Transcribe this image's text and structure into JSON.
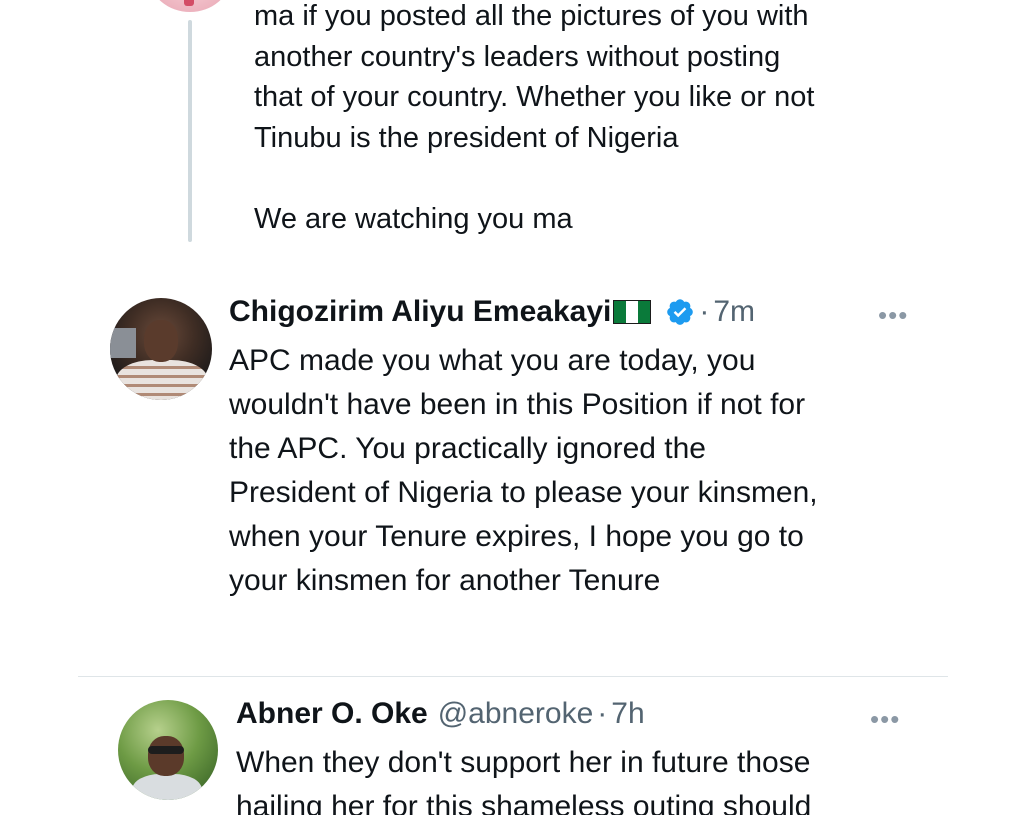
{
  "tweet1": {
    "lines": [
      "ma if you posted all the pictures of you with",
      "another country's leaders without posting",
      "that of your country. Whether you like or not",
      "Tinubu is the president of Nigeria",
      "We are watching you ma"
    ]
  },
  "tweet2": {
    "author_name": "Chigozirim Aliyu Emeakayi",
    "separator": "·",
    "time": "7m",
    "more": "•••",
    "flag_icon": "nigeria-flag-icon",
    "verified_icon": "verified-badge-icon",
    "verified_color": "#1d9bf0",
    "lines": [
      "APC made you what you are today, you",
      "wouldn't have been in this Position if not for",
      "the APC. You practically ignored the",
      "President of Nigeria to please your kinsmen,",
      "when your Tenure expires, I hope you go to",
      "your kinsmen for another Tenure"
    ]
  },
  "tweet3": {
    "author_name": "Abner O. Oke",
    "handle": "@abneroke",
    "separator": "·",
    "time": "7h",
    "more": "•••",
    "lines": [
      "When they don't support her in future those",
      "hailing her for this shameless outing should"
    ]
  }
}
